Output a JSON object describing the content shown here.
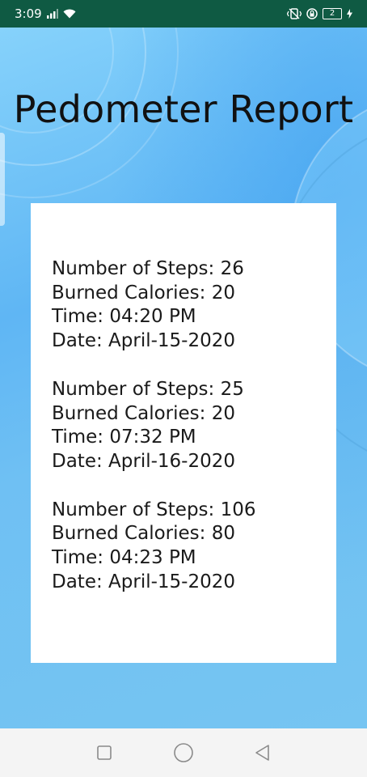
{
  "status_bar": {
    "time": "3:09",
    "battery_level": "2",
    "icons": [
      "signal-icon",
      "wifi-icon",
      "vibrate-icon",
      "rotation-lock-icon",
      "battery-icon",
      "charging-icon"
    ]
  },
  "header": {
    "title": "Pedometer Report"
  },
  "records": [
    {
      "steps": "Number of Steps: 26",
      "calories": "Burned Calories: 20",
      "time": "Time: 04:20 PM",
      "date": "Date: April-15-2020"
    },
    {
      "steps": "Number of Steps: 25",
      "calories": "Burned Calories: 20",
      "time": "Time: 07:32 PM",
      "date": "Date: April-16-2020"
    },
    {
      "steps": "Number of Steps: 106",
      "calories": "Burned Calories: 80",
      "time": "Time: 04:23 PM",
      "date": "Date: April-15-2020"
    }
  ],
  "nav_bar": {
    "icons": [
      "recents-icon",
      "home-icon",
      "back-icon"
    ]
  },
  "colors": {
    "status_bar": "#0f5a43",
    "background": "#74c4f2",
    "card": "#ffffff",
    "text": "#1a1a1a"
  }
}
